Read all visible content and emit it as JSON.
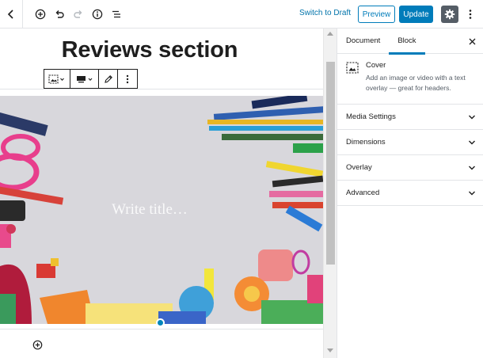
{
  "toolbar": {
    "switch_to_draft": "Switch to Draft",
    "preview": "Preview",
    "update": "Update",
    "icons": [
      "back-chevron-icon",
      "add-block-icon",
      "undo-icon",
      "redo-icon",
      "info-icon",
      "outline-icon",
      "gear-icon",
      "more-vertical-icon"
    ]
  },
  "editor": {
    "page_title": "Reviews section",
    "cover_title_placeholder": "Write title…",
    "block_toolbar_icons": [
      "cover-block-icon",
      "align-icon",
      "edit-pencil-icon",
      "more-options-icon"
    ]
  },
  "sidebar": {
    "tabs": [
      "Document",
      "Block"
    ],
    "active_tab": "Block",
    "block": {
      "name": "Cover",
      "description": "Add an image or video with a text overlay — great for headers."
    },
    "panels": [
      "Media Settings",
      "Dimensions",
      "Overlay",
      "Advanced"
    ]
  },
  "colors": {
    "accent": "#007cba",
    "link": "#0073aa",
    "settings_bg": "#555d66"
  }
}
